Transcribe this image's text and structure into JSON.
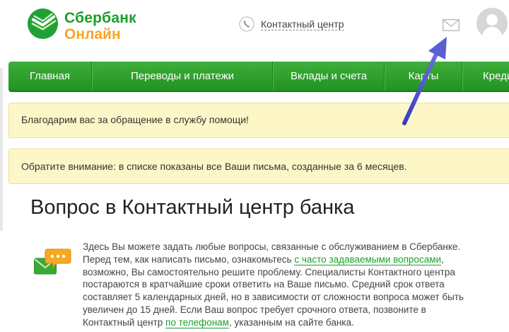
{
  "header": {
    "logo_line1": "Сбербанк",
    "logo_line2": "Онлайн",
    "contact_label": "Контактный центр",
    "icons": [
      "sberbank-logo-icon",
      "phone-icon",
      "mail-icon",
      "avatar"
    ]
  },
  "nav": {
    "items": [
      {
        "label": "Главная"
      },
      {
        "label": "Переводы и платежи"
      },
      {
        "label": "Вклады и счета"
      },
      {
        "label": "Карты"
      },
      {
        "label": "Креди"
      }
    ]
  },
  "notices": {
    "thanks": "Благодарим вас за обращение в службу помощи!",
    "attention": "Обратите внимание: в списке показаны все Ваши письма, созданные за 6 месяцев."
  },
  "main": {
    "title": "Вопрос в Контактный центр банка",
    "intro": {
      "l1": "Здесь Вы можете задать любые вопросы, связанные с обслуживанием в Сбербанке.",
      "l2_before": "Перед тем, как написать письмо, ознакомьтесь ",
      "l2_link": "с часто задаваемыми вопросами",
      "l2_after": ",",
      "l3": "возможно, Вы самостоятельно решите проблему. Специалисты Контактного центра",
      "l4": "постараются в кратчайшие сроки ответить на Ваше письмо. Средний срок ответа",
      "l5": "составляет 5 календарных дней, но в зависимости от сложности вопроса может быть",
      "l6": "увеличен до 15 дней. Если Ваш вопрос требует срочного ответа, позвоните в",
      "l7_before": "Контактный центр ",
      "l7_link": "по телефонам",
      "l7_after": ", указанным на сайте банка."
    }
  },
  "colors": {
    "brand_green": "#1a9f29",
    "brand_orange": "#f5a623",
    "nav_green": "#2fa12f",
    "notice_bg": "#fdf7c7",
    "annotation_arrow": "#4a4fc8"
  }
}
